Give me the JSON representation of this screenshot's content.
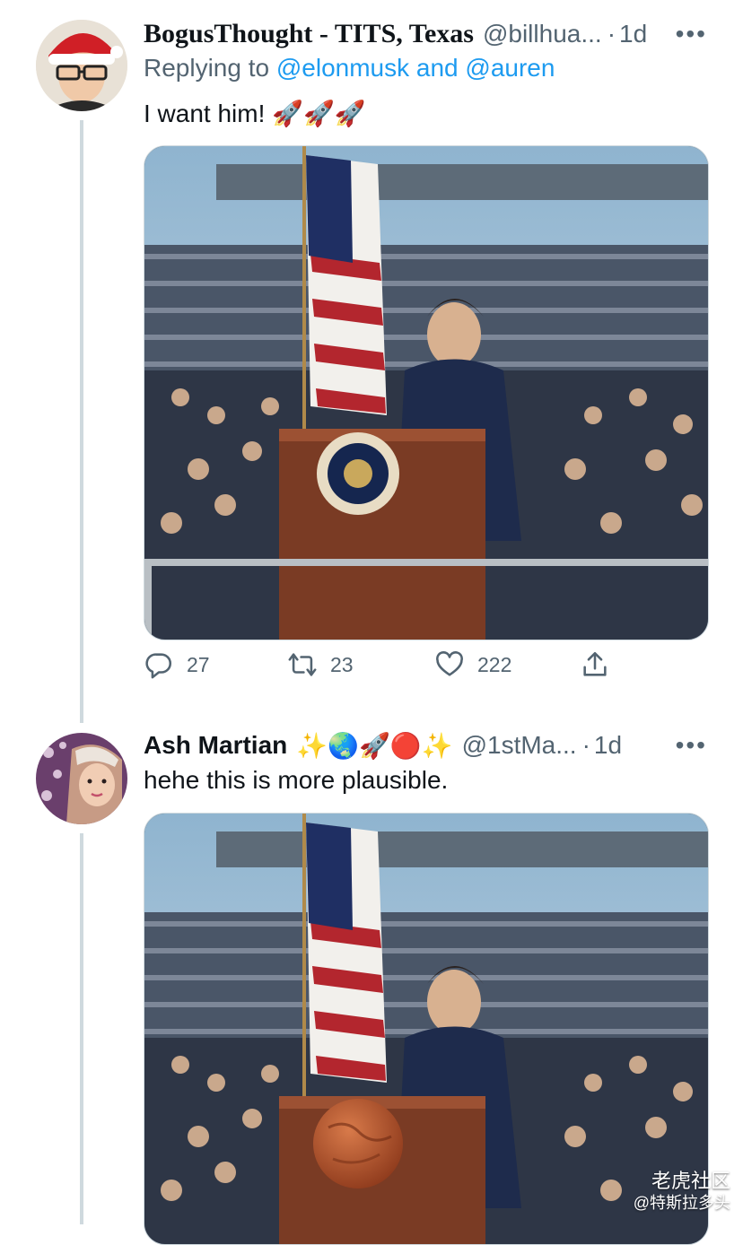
{
  "tweets": [
    {
      "name": "BogusThought - TITS, Texas",
      "handle": "@billhua...",
      "dot": "·",
      "time": "1d",
      "more": "•••",
      "reply_prefix": "Replying to",
      "reply_users": "@elonmusk and @auren",
      "text": "I want him!",
      "emoji_text": "🚀🚀🚀",
      "actions": {
        "reply_count": "27",
        "retweet_count": "23",
        "like_count": "222"
      },
      "icons": [
        "reply-icon",
        "retweet-icon",
        "like-icon",
        "share-icon"
      ]
    },
    {
      "name": "Ash Martian",
      "name_emojis": "✨🌏🚀🔴✨",
      "handle": "@1stMa...",
      "dot": "·",
      "time": "1d",
      "more": "•••",
      "text": "hehe this is more plausible."
    }
  ],
  "watermark": {
    "line1": "老虎社区",
    "line2": "@特斯拉多头"
  },
  "colors": {
    "link": "#1d9bf0",
    "secondary_text": "#536471",
    "thread_line": "#cfd9de"
  }
}
